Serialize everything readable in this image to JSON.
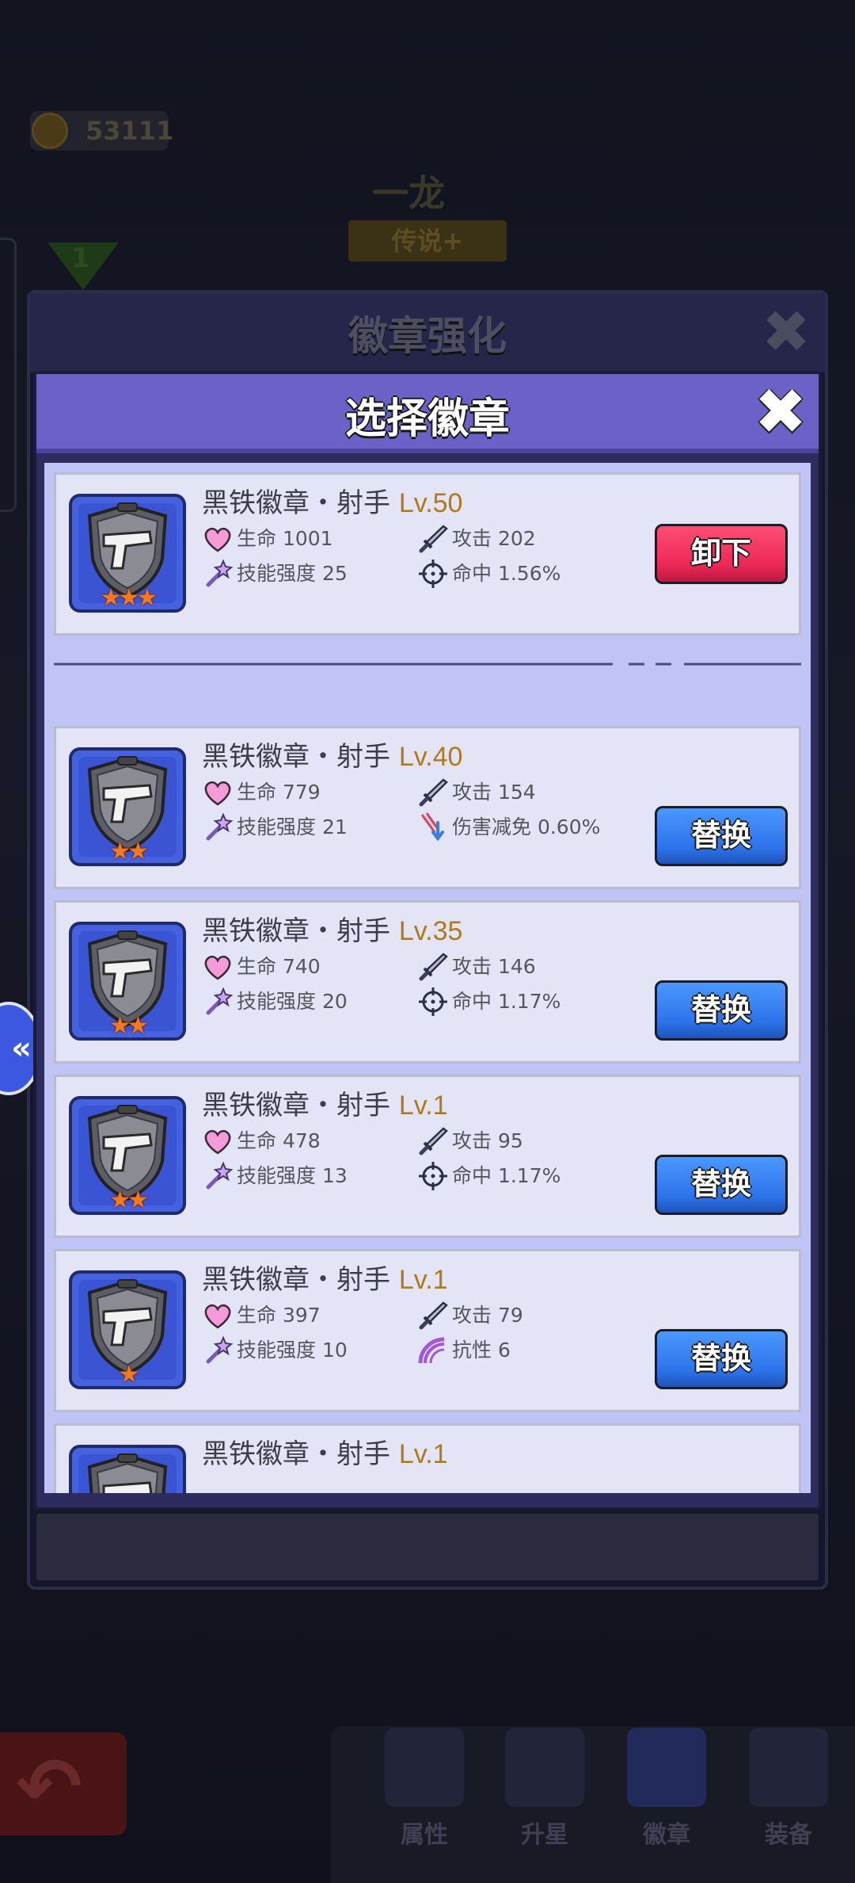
{
  "background": {
    "coins": "53111",
    "hero_name": "一龙",
    "hero_rank": "传说+",
    "hero_level": "1",
    "back_label": "",
    "nav": [
      {
        "label": "属性",
        "icon": "sword-icon"
      },
      {
        "label": "升星",
        "icon": "star-icon"
      },
      {
        "label": "徽章",
        "icon": "shield-badge-icon",
        "active": true
      },
      {
        "label": "装备",
        "icon": "bullet-icon"
      }
    ]
  },
  "outer_panel": {
    "title": "徽章强化",
    "close_icon": "close-icon"
  },
  "dialog": {
    "title": "选择徽章",
    "close_icon": "close-icon"
  },
  "colors": {
    "unequip_button": "#ec2857",
    "replace_button": "#2d74ec",
    "level_text": "#b0791b",
    "dialog_header": "#6b61c7",
    "list_background": "#bfc3f5"
  },
  "badges": [
    {
      "name": "黑铁徽章・射手",
      "level": "Lv.50",
      "stars": "★★★",
      "stats": [
        {
          "icon": "heart-icon",
          "text": "生命 1001"
        },
        {
          "icon": "sword-icon",
          "text": "攻击 202"
        },
        {
          "icon": "magic-wand-icon",
          "text": "技能强度 25"
        },
        {
          "icon": "crosshair-icon",
          "text": "命中 1.56%"
        }
      ],
      "button": "卸下",
      "equipped": true
    },
    {
      "name": "黑铁徽章・射手",
      "level": "Lv.40",
      "stars": "★★",
      "stats": [
        {
          "icon": "heart-icon",
          "text": "生命 779"
        },
        {
          "icon": "sword-icon",
          "text": "攻击 154"
        },
        {
          "icon": "magic-wand-icon",
          "text": "技能强度 21"
        },
        {
          "icon": "damage-reduction-icon",
          "text": "伤害减免 0.60%"
        }
      ],
      "button": "替换",
      "equipped": false
    },
    {
      "name": "黑铁徽章・射手",
      "level": "Lv.35",
      "stars": "★★",
      "stats": [
        {
          "icon": "heart-icon",
          "text": "生命 740"
        },
        {
          "icon": "sword-icon",
          "text": "攻击 146"
        },
        {
          "icon": "magic-wand-icon",
          "text": "技能强度 20"
        },
        {
          "icon": "crosshair-icon",
          "text": "命中 1.17%"
        }
      ],
      "button": "替换",
      "equipped": false
    },
    {
      "name": "黑铁徽章・射手",
      "level": "Lv.1",
      "stars": "★★",
      "stats": [
        {
          "icon": "heart-icon",
          "text": "生命 478"
        },
        {
          "icon": "sword-icon",
          "text": "攻击 95"
        },
        {
          "icon": "magic-wand-icon",
          "text": "技能强度 13"
        },
        {
          "icon": "crosshair-icon",
          "text": "命中 1.17%"
        }
      ],
      "button": "替换",
      "equipped": false
    },
    {
      "name": "黑铁徽章・射手",
      "level": "Lv.1",
      "stars": "★",
      "stats": [
        {
          "icon": "heart-icon",
          "text": "生命 397"
        },
        {
          "icon": "sword-icon",
          "text": "攻击 79"
        },
        {
          "icon": "magic-wand-icon",
          "text": "技能强度 10"
        },
        {
          "icon": "resistance-icon",
          "text": "抗性 6"
        }
      ],
      "button": "替换",
      "equipped": false
    },
    {
      "name": "黑铁徽章・射手",
      "level": "Lv.1",
      "stars": "",
      "stats": [],
      "button": "",
      "equipped": false
    }
  ]
}
